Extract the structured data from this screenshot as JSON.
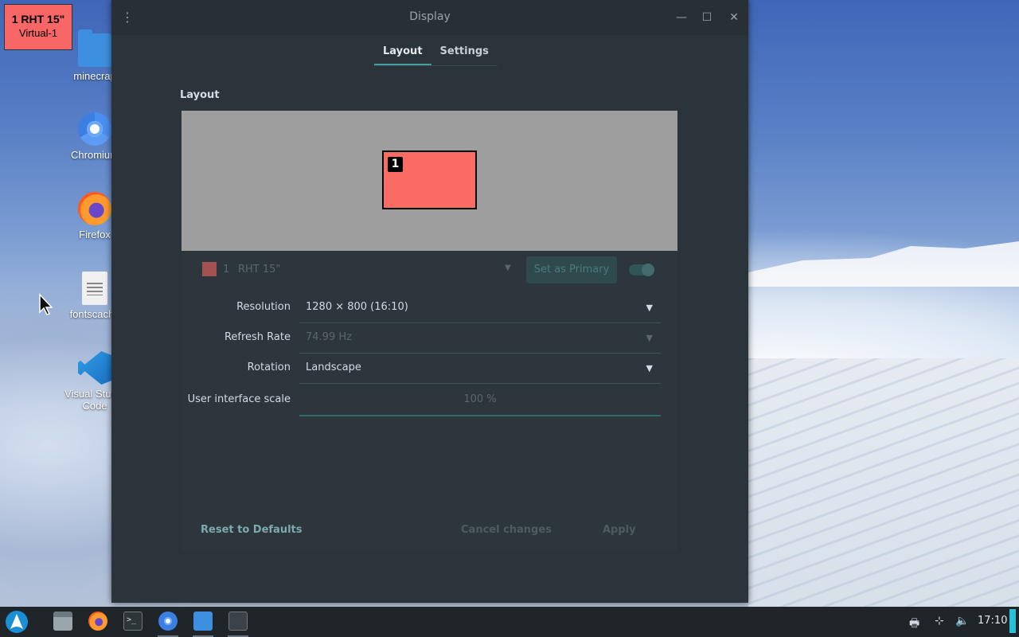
{
  "monitor_tag": {
    "line1": "1 RHT 15\"",
    "line2": "Virtual-1"
  },
  "desktop_icons": [
    {
      "label": "minecrap",
      "icon": "folder-icon"
    },
    {
      "label": "Chromium",
      "icon": "chromium-icon"
    },
    {
      "label": "Firefox",
      "icon": "firefox-icon"
    },
    {
      "label": "fontscache",
      "icon": "text-file-icon"
    },
    {
      "label": "Visual Studio Code",
      "icon": "vscode-icon"
    }
  ],
  "window": {
    "title": "Display",
    "menu_glyph": "⋮",
    "minimize_glyph": "—",
    "maximize_glyph": "☐",
    "close_glyph": "✕",
    "tabs": [
      {
        "label": "Layout",
        "active": true
      },
      {
        "label": "Settings",
        "active": false
      }
    ],
    "section_label": "Layout",
    "arrangement": {
      "monitor_number": "1",
      "monitor_color": "#fa6b63"
    },
    "monitor_row": {
      "id": "1",
      "name": "RHT 15\"",
      "primary_button": "Set as Primary",
      "enabled": true
    },
    "form": {
      "resolution": {
        "label": "Resolution",
        "value": "1280 × 800 (16:10)"
      },
      "refresh_rate": {
        "label": "Refresh Rate",
        "value": "74.99 Hz"
      },
      "rotation": {
        "label": "Rotation",
        "value": "Landscape"
      },
      "scale": {
        "label": "User interface scale",
        "value": "100 %"
      }
    },
    "buttons": {
      "reset": "Reset to Defaults",
      "cancel": "Cancel changes",
      "apply": "Apply"
    }
  },
  "taskbar": {
    "apps": [
      {
        "name": "file-manager-grey",
        "running": false
      },
      {
        "name": "firefox",
        "running": false
      },
      {
        "name": "terminal",
        "running": false
      },
      {
        "name": "chromium",
        "running": true
      },
      {
        "name": "files",
        "running": true
      },
      {
        "name": "display-settings",
        "running": true
      }
    ],
    "terminal_glyph": ">_",
    "clock": "17:10"
  },
  "colors": {
    "accent": "#3f9f9c",
    "window_bg": "#2b343a",
    "monitor_red": "#fa6b63",
    "taskbar_bg": "#1f2529"
  }
}
